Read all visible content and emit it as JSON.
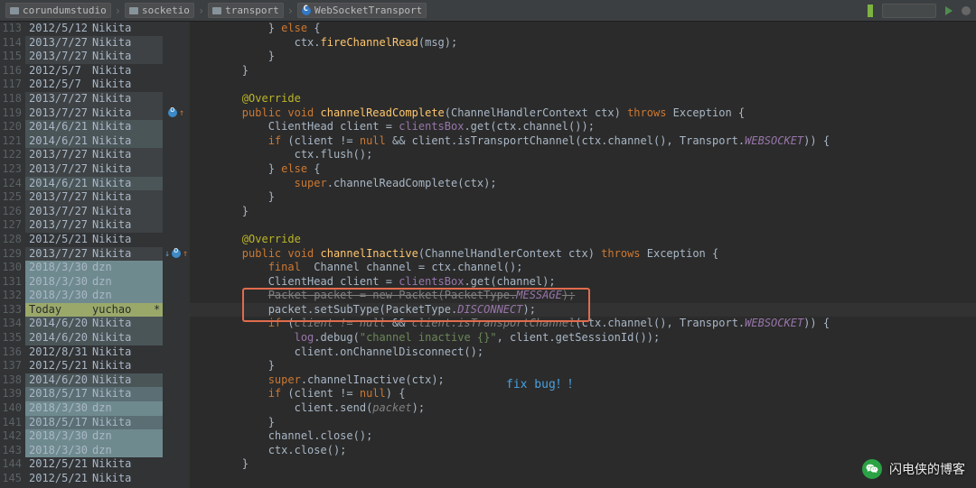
{
  "breadcrumb": {
    "items": [
      {
        "label": "corundumstudio",
        "icon": "folder"
      },
      {
        "label": "socketio",
        "icon": "folder"
      },
      {
        "label": "transport",
        "icon": "folder"
      },
      {
        "label": "WebSocketTransport",
        "icon": "class"
      }
    ]
  },
  "annotation": {
    "fix_bug": "fix bug！！"
  },
  "watermark": {
    "text": "闪电侠的博客"
  },
  "lines": [
    {
      "n": 113,
      "blame": {
        "date": "2012/5/12",
        "author": "Nikita",
        "heat": 0
      },
      "code": [
        {
          "t": "            } ",
          "c": "punct"
        },
        {
          "t": "else",
          "c": "kw"
        },
        {
          "t": " {",
          "c": "punct"
        }
      ]
    },
    {
      "n": 114,
      "blame": {
        "date": "2013/7/27",
        "author": "Nikita",
        "heat": 1
      },
      "code": [
        {
          "t": "                ctx.",
          "c": "param"
        },
        {
          "t": "fireChannelRead",
          "c": "method"
        },
        {
          "t": "(msg);",
          "c": "punct"
        }
      ]
    },
    {
      "n": 115,
      "blame": {
        "date": "2013/7/27",
        "author": "Nikita",
        "heat": 1
      },
      "code": [
        {
          "t": "            }",
          "c": "punct"
        }
      ]
    },
    {
      "n": 116,
      "blame": {
        "date": "2012/5/7",
        "author": "Nikita",
        "heat": 0
      },
      "code": [
        {
          "t": "        }",
          "c": "punct"
        }
      ]
    },
    {
      "n": 117,
      "blame": {
        "date": "2012/5/7",
        "author": "Nikita",
        "heat": 0
      },
      "code": [
        {
          "t": " ",
          "c": "punct"
        }
      ]
    },
    {
      "n": 118,
      "blame": {
        "date": "2013/7/27",
        "author": "Nikita",
        "heat": 1
      },
      "code": [
        {
          "t": "        ",
          "c": "punct"
        },
        {
          "t": "@Override",
          "c": "anno"
        }
      ]
    },
    {
      "n": 119,
      "blame": {
        "date": "2013/7/27",
        "author": "Nikita",
        "heat": 1
      },
      "icon": "impl",
      "code": [
        {
          "t": "        ",
          "c": "punct"
        },
        {
          "t": "public void ",
          "c": "kw"
        },
        {
          "t": "channelReadComplete",
          "c": "method"
        },
        {
          "t": "(ChannelHandlerContext ctx) ",
          "c": "type"
        },
        {
          "t": "throws",
          "c": "kw"
        },
        {
          "t": " Exception {",
          "c": "type"
        }
      ]
    },
    {
      "n": 120,
      "blame": {
        "date": "2014/6/21",
        "author": "Nikita",
        "heat": 2
      },
      "code": [
        {
          "t": "            ClientHead client = ",
          "c": "type"
        },
        {
          "t": "clientsBox",
          "c": "field"
        },
        {
          "t": ".get(ctx.channel());",
          "c": "punct"
        }
      ]
    },
    {
      "n": 121,
      "blame": {
        "date": "2014/6/21",
        "author": "Nikita",
        "heat": 2
      },
      "code": [
        {
          "t": "            ",
          "c": "punct"
        },
        {
          "t": "if",
          "c": "kw"
        },
        {
          "t": " (client != ",
          "c": "punct"
        },
        {
          "t": "null",
          "c": "kw"
        },
        {
          "t": " && client.isTransportChannel(ctx.channel(), Transport.",
          "c": "punct"
        },
        {
          "t": "WEBSOCKET",
          "c": "const"
        },
        {
          "t": ")) {",
          "c": "punct"
        }
      ]
    },
    {
      "n": 122,
      "blame": {
        "date": "2013/7/27",
        "author": "Nikita",
        "heat": 1
      },
      "code": [
        {
          "t": "                ctx.flush();",
          "c": "punct"
        }
      ]
    },
    {
      "n": 123,
      "blame": {
        "date": "2013/7/27",
        "author": "Nikita",
        "heat": 1
      },
      "code": [
        {
          "t": "            } ",
          "c": "punct"
        },
        {
          "t": "else",
          "c": "kw"
        },
        {
          "t": " {",
          "c": "punct"
        }
      ]
    },
    {
      "n": 124,
      "blame": {
        "date": "2014/6/21",
        "author": "Nikita",
        "heat": 2
      },
      "code": [
        {
          "t": "                ",
          "c": "punct"
        },
        {
          "t": "super",
          "c": "kw"
        },
        {
          "t": ".channelReadComplete(ctx);",
          "c": "punct"
        }
      ]
    },
    {
      "n": 125,
      "blame": {
        "date": "2013/7/27",
        "author": "Nikita",
        "heat": 1
      },
      "code": [
        {
          "t": "            }",
          "c": "punct"
        }
      ]
    },
    {
      "n": 126,
      "blame": {
        "date": "2013/7/27",
        "author": "Nikita",
        "heat": 1
      },
      "code": [
        {
          "t": "        }",
          "c": "punct"
        }
      ]
    },
    {
      "n": 127,
      "blame": {
        "date": "2013/7/27",
        "author": "Nikita",
        "heat": 1
      },
      "code": [
        {
          "t": " ",
          "c": "punct"
        }
      ]
    },
    {
      "n": 128,
      "blame": {
        "date": "2012/5/21",
        "author": "Nikita",
        "heat": 0
      },
      "code": [
        {
          "t": "        ",
          "c": "punct"
        },
        {
          "t": "@Override",
          "c": "anno"
        }
      ]
    },
    {
      "n": 129,
      "blame": {
        "date": "2013/7/27",
        "author": "Nikita",
        "heat": 1
      },
      "icon": "override-both",
      "code": [
        {
          "t": "        ",
          "c": "punct"
        },
        {
          "t": "public void ",
          "c": "kw"
        },
        {
          "t": "channelInactive",
          "c": "method"
        },
        {
          "t": "(ChannelHandlerContext ctx) ",
          "c": "type"
        },
        {
          "t": "throws",
          "c": "kw"
        },
        {
          "t": " Exception {",
          "c": "type"
        }
      ]
    },
    {
      "n": 130,
      "blame": {
        "date": "2018/3/30",
        "author": "dzn",
        "heat": 4
      },
      "code": [
        {
          "t": "            ",
          "c": "punct"
        },
        {
          "t": "final",
          "c": "kw"
        },
        {
          "t": "  Channel channel = ctx.channel();",
          "c": "punct"
        }
      ]
    },
    {
      "n": 131,
      "blame": {
        "date": "2018/3/30",
        "author": "dzn",
        "heat": 4
      },
      "code": [
        {
          "t": "            ClientHead client = ",
          "c": "type"
        },
        {
          "t": "clientsBox",
          "c": "field"
        },
        {
          "t": ".get(channel);",
          "c": "punct"
        }
      ]
    },
    {
      "n": 132,
      "blame": {
        "date": "2018/3/30",
        "author": "dzn",
        "heat": 4
      },
      "code": [
        {
          "t": "            ",
          "c": "punct"
        },
        {
          "t": "Packet packet = new Packet(PacketType.",
          "c": "strike"
        },
        {
          "t": "MESSAGE",
          "c": "const"
        },
        {
          "t": ");",
          "c": "strike"
        }
      ]
    },
    {
      "n": 133,
      "blame": {
        "date": "Today",
        "author": "yuchao",
        "heat": "today",
        "star": "*"
      },
      "current": true,
      "code": [
        {
          "t": "            packet.setSubType(PacketType.",
          "c": "punct"
        },
        {
          "t": "DISCONNECT",
          "c": "const"
        },
        {
          "t": ");",
          "c": "punct"
        }
      ]
    },
    {
      "n": 134,
      "blame": {
        "date": "2014/6/20",
        "author": "Nikita",
        "heat": 2
      },
      "code": [
        {
          "t": "            ",
          "c": "punct"
        },
        {
          "t": "if",
          "c": "kw"
        },
        {
          "t": " (",
          "c": "punct"
        },
        {
          "t": "client != null",
          "c": "greyish"
        },
        {
          "t": " && ",
          "c": "punct"
        },
        {
          "t": "client.isTransportChannel",
          "c": "greyish"
        },
        {
          "t": "(ctx.channel(), Transport.",
          "c": "punct"
        },
        {
          "t": "WEBSOCKET",
          "c": "const"
        },
        {
          "t": ")) {",
          "c": "punct"
        }
      ]
    },
    {
      "n": 135,
      "blame": {
        "date": "2014/6/20",
        "author": "Nikita",
        "heat": 2
      },
      "code": [
        {
          "t": "                ",
          "c": "punct"
        },
        {
          "t": "log",
          "c": "field"
        },
        {
          "t": ".debug(",
          "c": "punct"
        },
        {
          "t": "\"channel inactive {}\"",
          "c": "str"
        },
        {
          "t": ", client.getSessionId());",
          "c": "punct"
        }
      ]
    },
    {
      "n": 136,
      "blame": {
        "date": "2012/8/31",
        "author": "Nikita",
        "heat": 0
      },
      "code": [
        {
          "t": "                client.onChannelDisconnect();",
          "c": "punct"
        }
      ]
    },
    {
      "n": 137,
      "blame": {
        "date": "2012/5/21",
        "author": "Nikita",
        "heat": 0
      },
      "code": [
        {
          "t": "            }",
          "c": "punct"
        }
      ]
    },
    {
      "n": 138,
      "blame": {
        "date": "2014/6/20",
        "author": "Nikita",
        "heat": 2
      },
      "code": [
        {
          "t": "            ",
          "c": "punct"
        },
        {
          "t": "super",
          "c": "kw"
        },
        {
          "t": ".channelInactive(ctx);",
          "c": "punct"
        }
      ]
    },
    {
      "n": 139,
      "blame": {
        "date": "2018/5/17",
        "author": "Nikita",
        "heat": 3
      },
      "code": [
        {
          "t": "            ",
          "c": "punct"
        },
        {
          "t": "if",
          "c": "kw"
        },
        {
          "t": " (client != ",
          "c": "punct"
        },
        {
          "t": "null",
          "c": "kw"
        },
        {
          "t": ") {",
          "c": "punct"
        }
      ]
    },
    {
      "n": 140,
      "blame": {
        "date": "2018/3/30",
        "author": "dzn",
        "heat": 4
      },
      "code": [
        {
          "t": "                client.send(",
          "c": "punct"
        },
        {
          "t": "packet",
          "c": "greyish"
        },
        {
          "t": ");",
          "c": "punct"
        }
      ]
    },
    {
      "n": 141,
      "blame": {
        "date": "2018/5/17",
        "author": "Nikita",
        "heat": 3
      },
      "code": [
        {
          "t": "            }",
          "c": "punct"
        }
      ]
    },
    {
      "n": 142,
      "blame": {
        "date": "2018/3/30",
        "author": "dzn",
        "heat": 4
      },
      "code": [
        {
          "t": "            channel.close();",
          "c": "punct"
        }
      ]
    },
    {
      "n": 143,
      "blame": {
        "date": "2018/3/30",
        "author": "dzn",
        "heat": 4
      },
      "code": [
        {
          "t": "            ctx.close();",
          "c": "punct"
        }
      ]
    },
    {
      "n": 144,
      "blame": {
        "date": "2012/5/21",
        "author": "Nikita",
        "heat": 0
      },
      "code": [
        {
          "t": "        }",
          "c": "punct"
        }
      ]
    },
    {
      "n": 145,
      "blame": {
        "date": "2012/5/21",
        "author": "Nikita",
        "heat": 0
      },
      "code": [
        {
          "t": " ",
          "c": "punct"
        }
      ]
    }
  ]
}
